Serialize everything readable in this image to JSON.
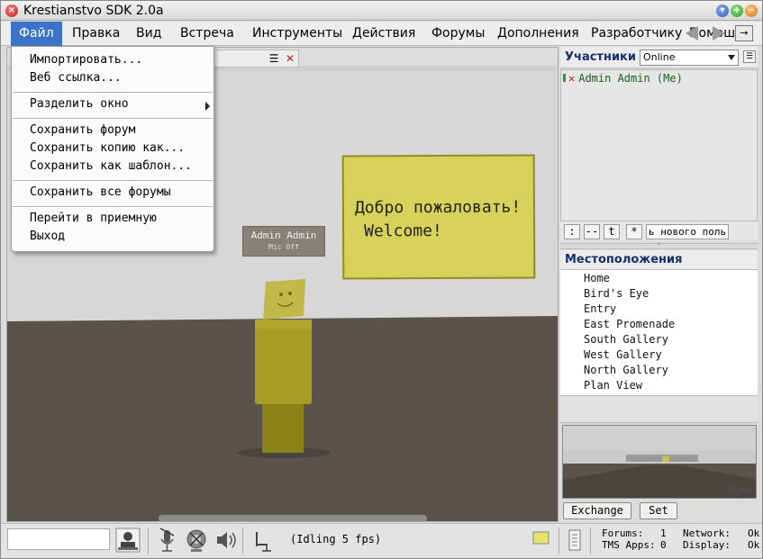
{
  "window": {
    "title": "Krestianstvo SDK 2.0a"
  },
  "menubar": {
    "items": [
      "Файл",
      "Правка",
      "Вид",
      "Встреча",
      "Инструменты",
      "Действия",
      "Форумы",
      "Дополнения",
      "Разработчику",
      "Помощ"
    ]
  },
  "file_menu": {
    "items": [
      "Импортировать...",
      "Веб ссылка...",
      "Разделить окно",
      "Сохранить форум",
      "Сохранить копию как...",
      "Сохранить как шаблон...",
      "Сохранить все форумы",
      "Перейти в приемную",
      "Выход"
    ]
  },
  "viewport": {
    "sign_line1": "Добро пожаловать!",
    "sign_line2": "Welcome!",
    "nametag_name": "Admin Admin",
    "nametag_status": "Mic Off",
    "colors": {
      "wall": "#d9d9d9",
      "floor": "#5a534c",
      "sign": "#d6d25a",
      "avatar": "#a79d24"
    }
  },
  "participants": {
    "title": "Участники",
    "status_value": "Online",
    "list": [
      "Admin Admin  (Me)"
    ],
    "chat_buttons": [
      ":",
      "--",
      "t",
      "*"
    ],
    "chat_input_value": "ь нового поль"
  },
  "locations": {
    "title": "Местоположения",
    "items": [
      "Home",
      "Bird's Eye",
      "Entry",
      "East Promenade",
      "South Gallery",
      "West Gallery",
      "North Gallery",
      "Plan View"
    ],
    "preview_label": "Home",
    "exchange_label": "Exchange",
    "set_label": "Set"
  },
  "statusbar": {
    "fps_text": "(Idling 5 fps)",
    "forums_label": "Forums:",
    "forums_value": "1",
    "network_label": "Network:",
    "network_value": "Ok",
    "tms_label": "TMS Apps:",
    "tms_value": "0",
    "display_label": "Display:",
    "display_value": "Ok"
  }
}
